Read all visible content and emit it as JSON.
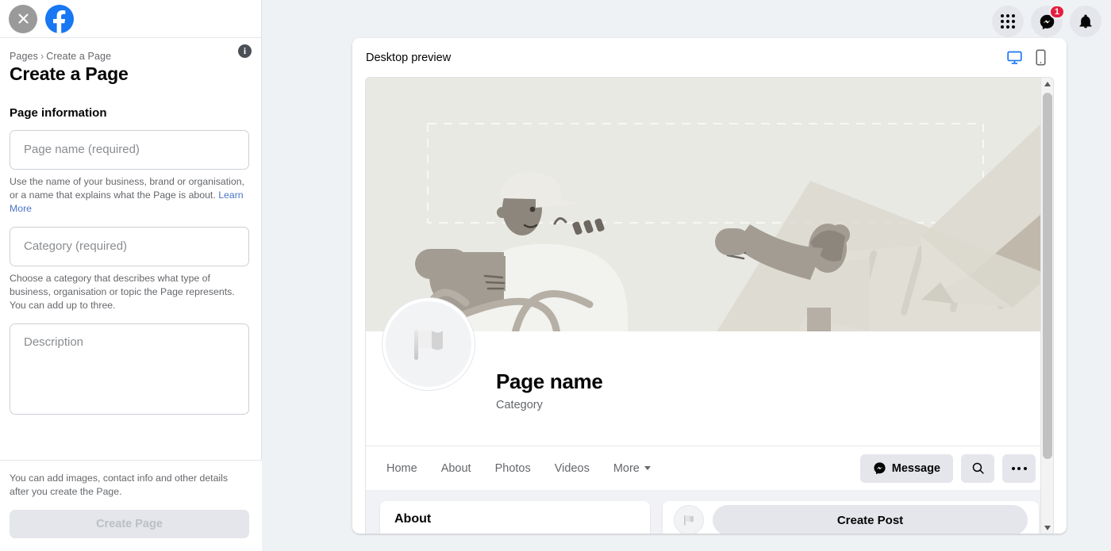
{
  "sidebar": {
    "close_icon": "close-x-icon",
    "logo": "facebook-logo",
    "breadcrumb": {
      "parent": "Pages",
      "separator": "›",
      "current": "Create a Page"
    },
    "title": "Create a Page",
    "info_icon_label": "i",
    "section_heading": "Page information",
    "fields": [
      {
        "name": "page-name",
        "placeholder": "Page name (required)",
        "help": "Use the name of your business, brand or organisation, or a name that explains what the Page is about. ",
        "help_link": "Learn More",
        "type": "input"
      },
      {
        "name": "category",
        "placeholder": "Category (required)",
        "help": "Choose a category that describes what type of business, organisation or topic the Page represents. You can add up to three.",
        "help_link": "",
        "type": "input"
      },
      {
        "name": "description",
        "placeholder": "Description",
        "help": "",
        "help_link": "",
        "type": "textarea"
      }
    ],
    "footer_note": "You can add images, contact info and other details after you create the Page.",
    "submit_label": "Create Page"
  },
  "topbar": {
    "apps_icon": "grid-apps-icon",
    "messenger_icon": "messenger-icon",
    "messenger_badge": "1",
    "notifications_icon": "bell-icon"
  },
  "preview": {
    "header_title": "Desktop preview",
    "desktop_toggle": "desktop-monitor-icon",
    "mobile_toggle": "mobile-phone-icon",
    "active_device": "desktop",
    "page": {
      "name": "Page name",
      "category": "Category",
      "avatar_icon": "flag-placeholder-icon",
      "nav": [
        {
          "label": "Home",
          "has_caret": false
        },
        {
          "label": "About",
          "has_caret": false
        },
        {
          "label": "Photos",
          "has_caret": false
        },
        {
          "label": "Videos",
          "has_caret": false
        },
        {
          "label": "More",
          "has_caret": true
        }
      ],
      "message_button": "Message",
      "search_icon": "search-icon",
      "more_icon": "ellipsis-icon",
      "about_card_title": "About",
      "create_post_label": "Create Post"
    }
  },
  "colors": {
    "brand_blue": "#1877f2",
    "page_bg": "#eff2f5",
    "panel_white": "#ffffff",
    "text_primary": "#050505",
    "text_secondary": "#65676b",
    "link_blue": "#4a76c4",
    "badge_red": "#e41e3f",
    "button_gray": "#e4e6eb",
    "cover_beige": "#e9e9e4"
  }
}
